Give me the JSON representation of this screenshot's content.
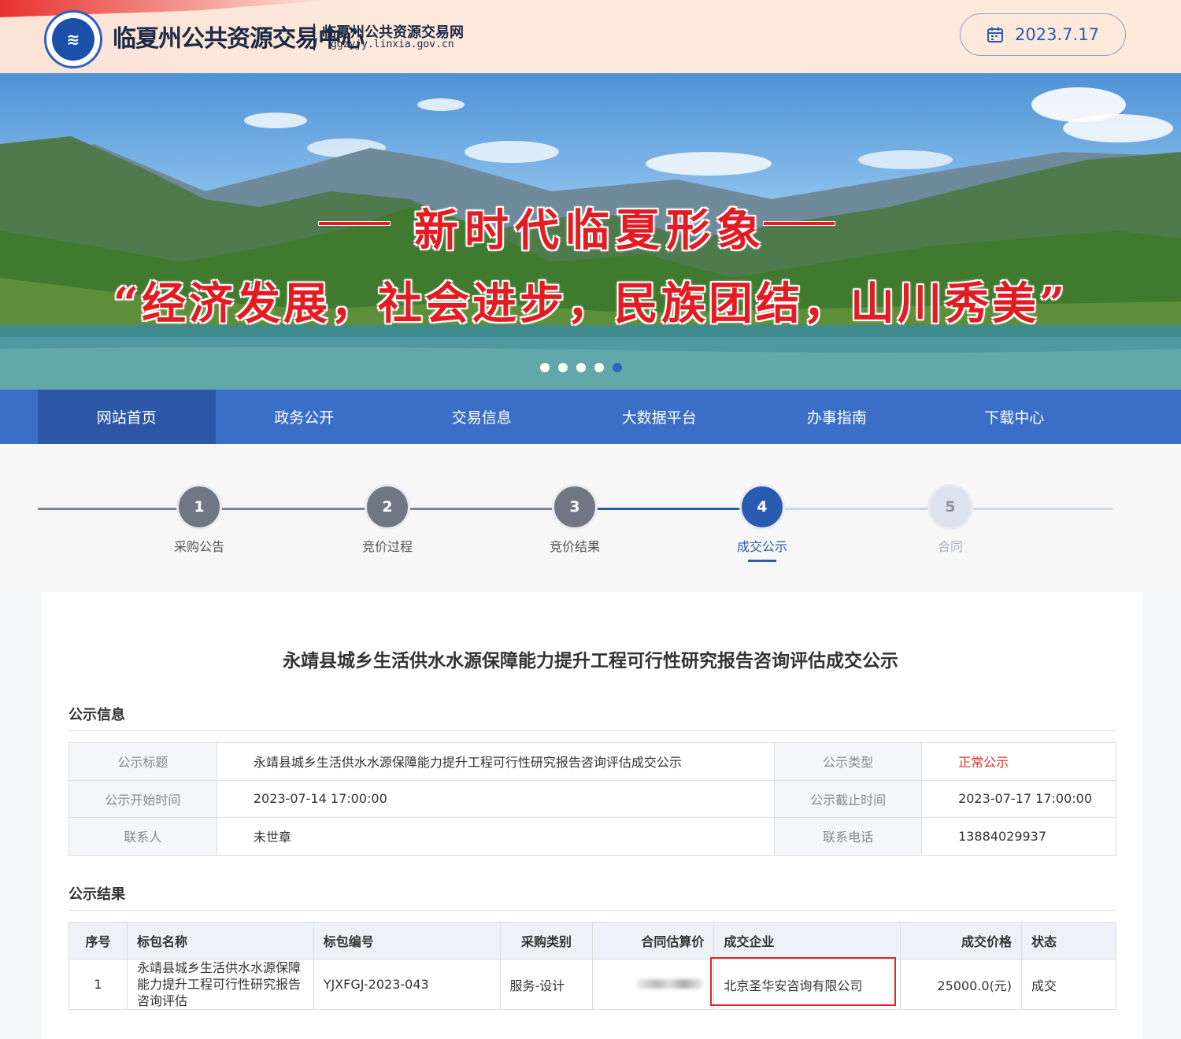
{
  "header": {
    "site_name": "临夏州公共资源交易中心",
    "site_sub": "临夏州公共资源交易网",
    "site_url": "ggzyjy.linxia.gov.cn",
    "date": "2023.7.17",
    "calendar_icon": "calendar-icon"
  },
  "banner": {
    "slogan_1": "新时代临夏形象",
    "slogan_2": "“经济发展，社会进步，民族团结，山川秀美”",
    "dots_count": 5,
    "active_dot": 5
  },
  "nav": {
    "items": [
      "网站首页",
      "政务公开",
      "交易信息",
      "大数据平台",
      "办事指南",
      "下载中心"
    ],
    "active": 0
  },
  "steps": [
    {
      "num": "1",
      "label": "采购公告",
      "state": "done"
    },
    {
      "num": "2",
      "label": "竞价过程",
      "state": "done"
    },
    {
      "num": "3",
      "label": "竞价结果",
      "state": "done"
    },
    {
      "num": "4",
      "label": "成交公示",
      "state": "active"
    },
    {
      "num": "5",
      "label": "合同",
      "state": "pending"
    }
  ],
  "page_title": "永靖县城乡生活供水水源保障能力提升工程可行性研究报告咨询评估成交公示",
  "info": {
    "section_title": "公示信息",
    "rows": [
      {
        "k1": "公示标题",
        "v1": "永靖县城乡生活供水水源保障能力提升工程可行性研究报告咨询评估成交公示",
        "k2": "公示类型",
        "v2": "正常公示"
      },
      {
        "k1": "公示开始时间",
        "v1": "2023-07-14 17:00:00",
        "k2": "公示截止时间",
        "v2": "2023-07-17 17:00:00"
      },
      {
        "k1": "联系人",
        "v1": "未世章",
        "k2": "联系电话",
        "v2": "13884029937"
      }
    ]
  },
  "result": {
    "section_title": "公示结果",
    "headers": [
      "序号",
      "标包名称",
      "标包编号",
      "采购类别",
      "合同估算价",
      "成交企业",
      "成交价格",
      "状态"
    ],
    "rows": [
      {
        "index": "1",
        "name": "永靖县城乡生活供水水源保障能力提升工程可行性研究报告咨询评估",
        "code": "YJXFGJ-2023-043",
        "category": "服务-设计",
        "estimate": "",
        "company": "北京圣华安咨询有限公司",
        "price": "25000.0(元)",
        "status": "成交"
      }
    ]
  },
  "colors": {
    "primary": "#3b6ec6",
    "nav_active": "#2d58a8",
    "accent_red": "#e3242b",
    "step_active": "#2a5bb3"
  }
}
